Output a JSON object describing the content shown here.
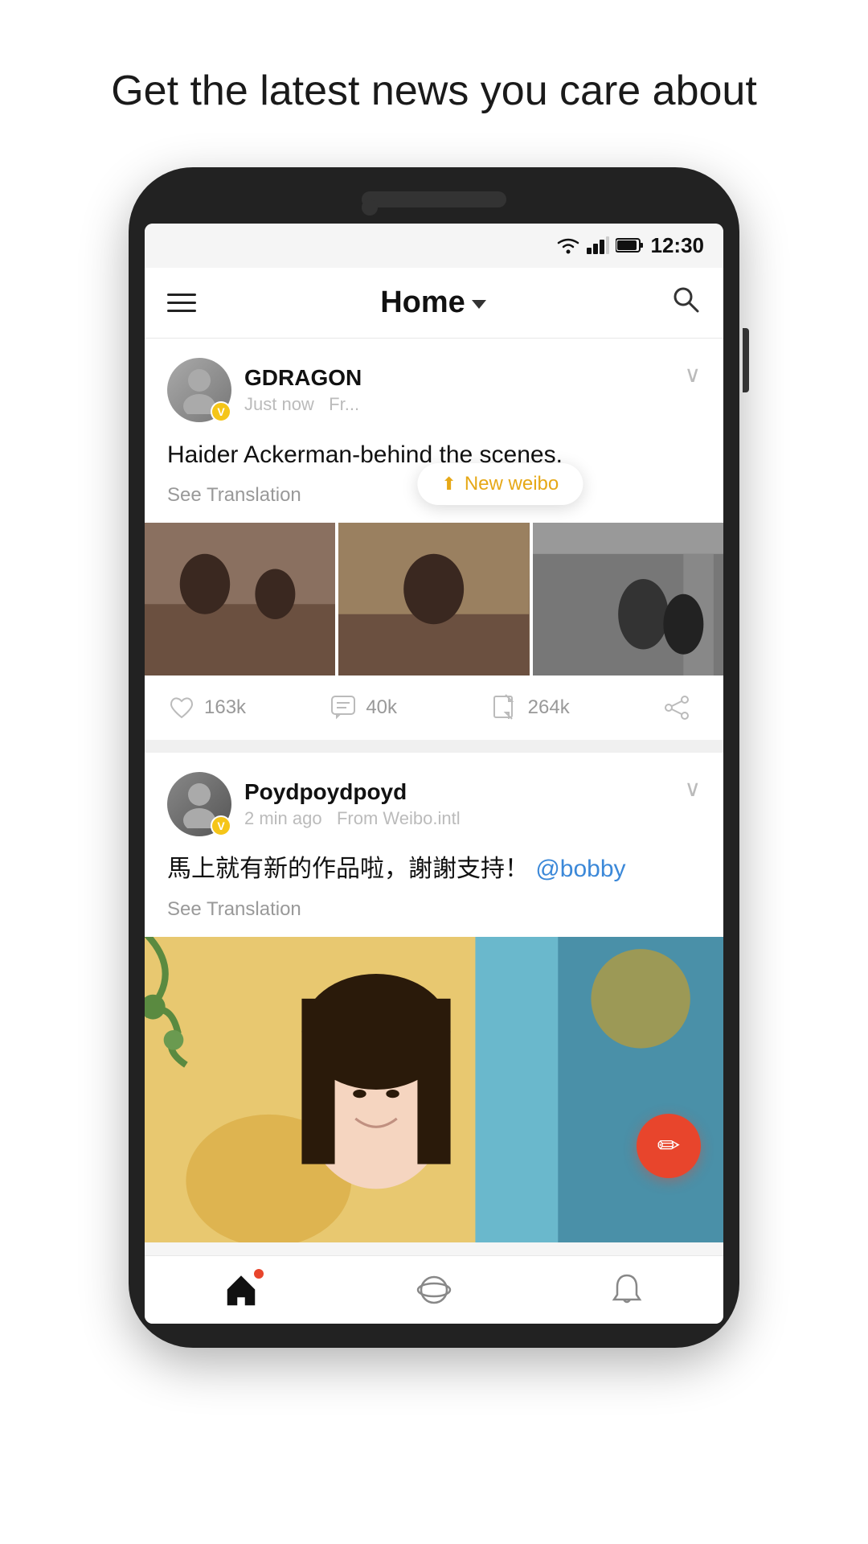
{
  "headline": "Get the latest news you care about",
  "statusBar": {
    "time": "12:30"
  },
  "header": {
    "title": "Home",
    "menuLabel": "menu",
    "searchLabel": "search"
  },
  "newWeibo": {
    "label": "New weibo",
    "icon": "↑"
  },
  "posts": [
    {
      "id": "post1",
      "author": "GDRAGON",
      "avatar": "G",
      "verified": true,
      "time": "Just now",
      "source": "Fr...",
      "content": "Haider Ackerman-behind the scenes.",
      "seeTranslation": "See Translation",
      "images": 3,
      "likes": "163k",
      "comments": "40k",
      "reposts": "264k"
    },
    {
      "id": "post2",
      "author": "Poydpoydpoyd",
      "avatar": "P",
      "verified": true,
      "time": "2 min ago",
      "source": "From Weibo.intl",
      "content": "馬上就有新的作品啦，謝謝支持！",
      "mention": "@bobby",
      "seeTranslation": "See Translation",
      "images": 1
    }
  ],
  "nav": {
    "home": "home",
    "explore": "explore",
    "notifications": "notifications"
  },
  "fab": {
    "icon": "✏"
  }
}
